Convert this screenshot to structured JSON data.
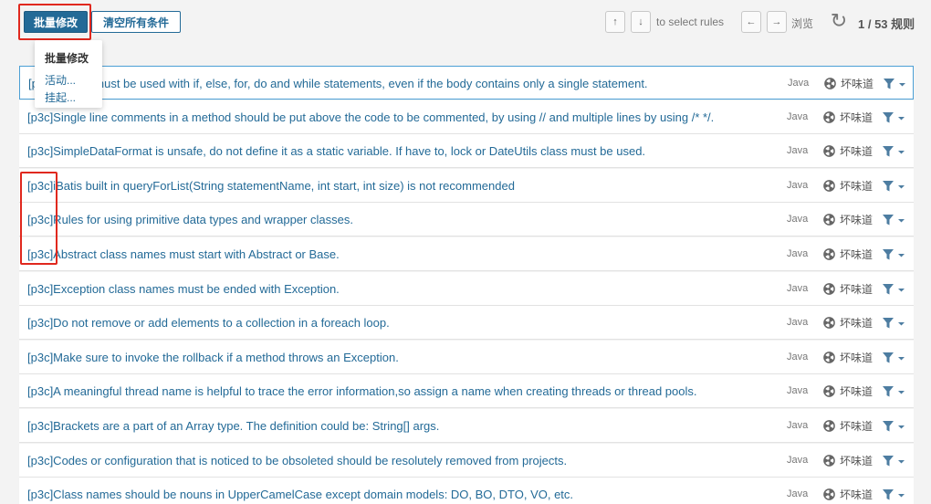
{
  "toolbar": {
    "bulk_change_label": "批量修改",
    "clear_all_label": "清空所有条件",
    "up_key": "↑",
    "down_key": "↓",
    "select_rules_hint": "to select rules",
    "left_key": "←",
    "right_key": "→",
    "browse_label": "浏览",
    "counter": "1 / 53 规则"
  },
  "dropdown": {
    "header": "批量修改",
    "items": [
      {
        "label": "活动..."
      },
      {
        "label": "挂起..."
      }
    ]
  },
  "rules": [
    {
      "title": "[p3c]Braces must be used with if, else, for, do and while statements, even if the body contains only a single statement.",
      "lang": "Java",
      "type": "坏味道"
    },
    {
      "title": "[p3c]Single line comments in a method should be put above the code to be commented, by using // and multiple lines by using /* */.",
      "lang": "Java",
      "type": "坏味道"
    },
    {
      "title": "[p3c]SimpleDataFormat is unsafe, do not define it as a static variable. If have to, lock or DateUtils class must be used.",
      "lang": "Java",
      "type": "坏味道"
    },
    {
      "title": "[p3c]iBatis built in queryForList(String statementName, int start, int size) is not recommended",
      "lang": "Java",
      "type": "坏味道"
    },
    {
      "title": "[p3c]Rules for using primitive data types and wrapper classes.",
      "lang": "Java",
      "type": "坏味道"
    },
    {
      "title": "[p3c]Abstract class names must start with Abstract or Base.",
      "lang": "Java",
      "type": "坏味道"
    },
    {
      "title": "[p3c]Exception class names must be ended with Exception.",
      "lang": "Java",
      "type": "坏味道"
    },
    {
      "title": "[p3c]Do not remove or add elements to a collection in a foreach loop.",
      "lang": "Java",
      "type": "坏味道"
    },
    {
      "title": "[p3c]Make sure to invoke the rollback if a method throws an Exception.",
      "lang": "Java",
      "type": "坏味道"
    },
    {
      "title": "[p3c]A meaningful thread name is helpful to trace the error information,so assign a name when creating threads or thread pools.",
      "lang": "Java",
      "type": "坏味道"
    },
    {
      "title": "[p3c]Brackets are a part of an Array type. The definition could be: String[] args.",
      "lang": "Java",
      "type": "坏味道"
    },
    {
      "title": "[p3c]Codes or configuration that is noticed to be obsoleted should be resolutely removed from projects.",
      "lang": "Java",
      "type": "坏味道"
    },
    {
      "title": "[p3c]Class names should be nouns in UpperCamelCase except domain models: DO, BO, DTO, VO, etc.",
      "lang": "Java",
      "type": "坏味道"
    }
  ],
  "icons": {
    "smell": "code-smell-icon",
    "filter": "filter-icon",
    "reload": "reload-icon"
  },
  "colors": {
    "link": "#236a97",
    "primary": "#236a97",
    "highlight": "#e0281e",
    "selected_border": "#4b9fd5"
  }
}
